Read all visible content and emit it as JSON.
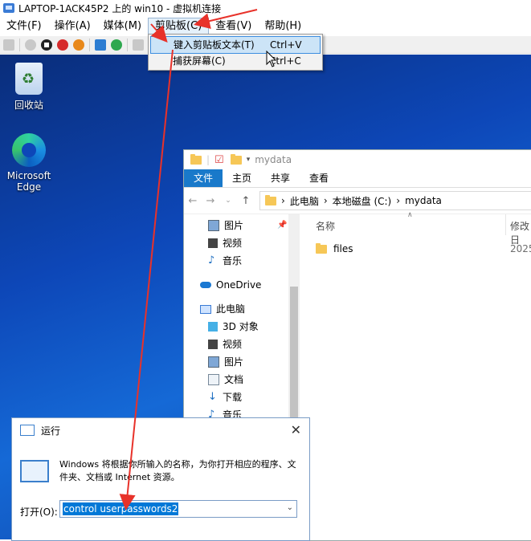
{
  "window": {
    "title": "LAPTOP-1ACK45P2 上的 win10 - 虚拟机连接"
  },
  "menubar": {
    "items": [
      "文件(F)",
      "操作(A)",
      "媒体(M)",
      "剪贴板(C)",
      "查看(V)",
      "帮助(H)"
    ]
  },
  "clipboard_menu": {
    "items": [
      {
        "label": "键入剪贴板文本(T)",
        "shortcut": "Ctrl+V"
      },
      {
        "label": "捕获屏幕(C)",
        "shortcut": "Ctrl+C"
      }
    ]
  },
  "desktop": {
    "icons": [
      "回收站",
      "Microsoft Edge"
    ]
  },
  "explorer": {
    "title": "mydata",
    "tabs": [
      "文件",
      "主页",
      "共享",
      "查看"
    ],
    "breadcrumb": [
      "此电脑",
      "本地磁盘 (C:)",
      "mydata"
    ],
    "nav": {
      "quick": [
        "图片",
        "视频",
        "音乐"
      ],
      "onedrive": "OneDrive",
      "thispc": "此电脑",
      "pc_items": [
        "3D 对象",
        "视频",
        "图片",
        "文档",
        "下载",
        "音乐"
      ]
    },
    "columns": {
      "name": "名称",
      "modified": "修改日"
    },
    "files": [
      {
        "name": "files",
        "date": "2025/"
      }
    ]
  },
  "run_dialog": {
    "title": "运行",
    "description": "Windows 将根据你所输入的名称，为你打开相应的程序、文件夹、文档或 Internet 资源。",
    "open_label": "打开(O):",
    "input_value": "control userpasswords2"
  },
  "colors": {
    "accent": "#1979ca",
    "arrow": "#e8322a"
  }
}
